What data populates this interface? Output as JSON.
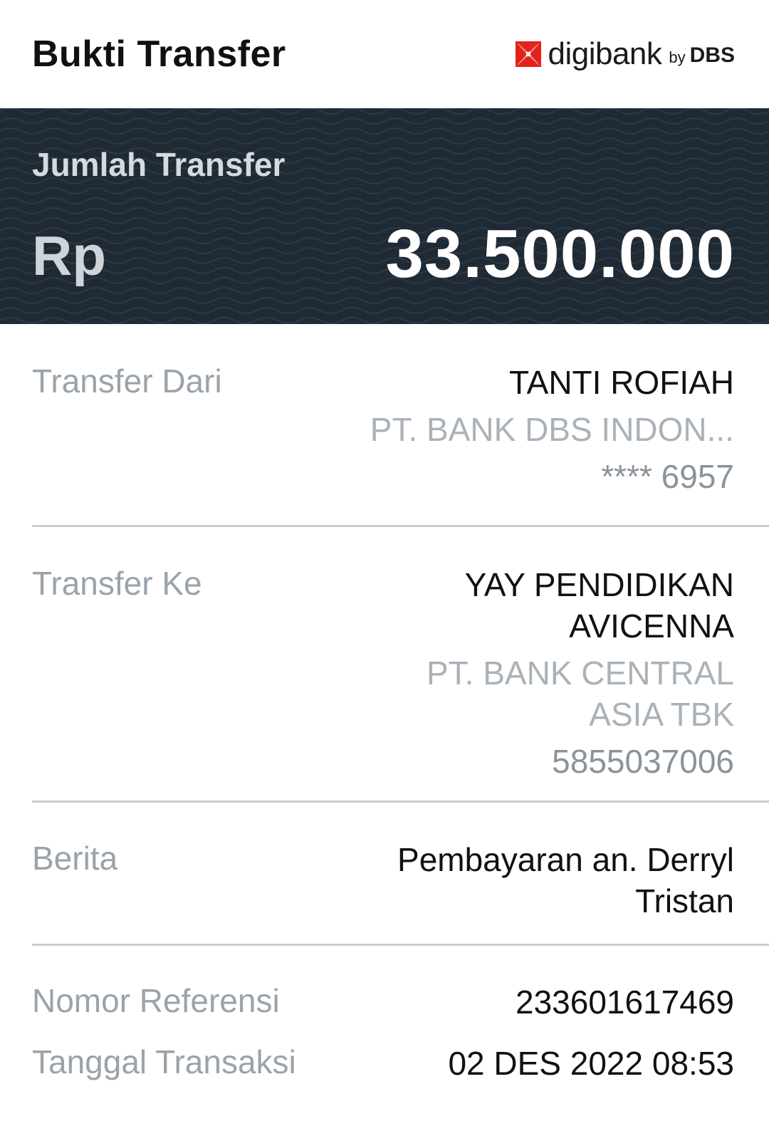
{
  "header": {
    "title": "Bukti Transfer",
    "brand": {
      "name": "digibank",
      "by": "by",
      "dbs": "DBS",
      "accent_color": "#e2231a"
    }
  },
  "amount_banner": {
    "label": "Jumlah Transfer",
    "currency": "Rp",
    "amount": "33.500.000",
    "background_color": "#1f2a35"
  },
  "transfer_from": {
    "label": "Transfer Dari",
    "name": "TANTI ROFIAH",
    "bank": "PT. BANK DBS INDON...",
    "account": "**** 6957"
  },
  "transfer_to": {
    "label": "Transfer Ke",
    "name_line1": "YAY PENDIDIKAN",
    "name_line2": "AVICENNA",
    "bank_line1": "PT. BANK CENTRAL",
    "bank_line2": "ASIA TBK",
    "account": "5855037006"
  },
  "message": {
    "label": "Berita",
    "line1": "Pembayaran an. Derryl",
    "line2": "Tristan"
  },
  "reference": {
    "label": "Nomor Referensi",
    "value": "233601617469"
  },
  "transaction_date": {
    "label": "Tanggal Transaksi",
    "value": "02 DES 2022 08:53"
  }
}
